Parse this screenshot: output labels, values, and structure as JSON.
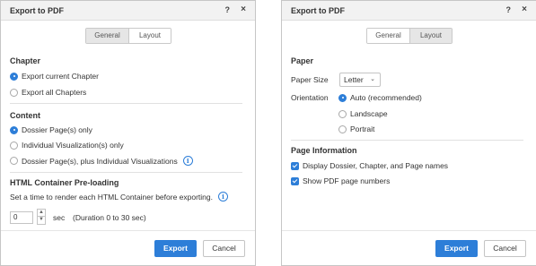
{
  "left": {
    "title": "Export to PDF",
    "help": "?",
    "close": "×",
    "tabs": [
      "General",
      "Layout"
    ],
    "chapter": {
      "heading": "Chapter",
      "options": [
        "Export current Chapter",
        "Export all Chapters"
      ],
      "selected": 0
    },
    "content": {
      "heading": "Content",
      "options": [
        "Dossier Page(s) only",
        "Individual Visualization(s) only",
        "Dossier Page(s), plus Individual Visualizations"
      ],
      "selected": 0
    },
    "preload": {
      "heading": "HTML Container Pre-loading",
      "description": "Set a time to render each HTML Container before exporting.",
      "value": "0",
      "unit": "sec",
      "hint": "(Duration 0 to 30 sec)"
    },
    "buttons": {
      "export": "Export",
      "cancel": "Cancel"
    }
  },
  "right": {
    "title": "Export to PDF",
    "help": "?",
    "close": "×",
    "tabs": [
      "General",
      "Layout"
    ],
    "paper": {
      "heading": "Paper",
      "size_label": "Paper Size",
      "size_value": "Letter",
      "orientation_label": "Orientation",
      "orientation_options": [
        "Auto (recommended)",
        "Landscape",
        "Portrait"
      ],
      "selected": 0
    },
    "page_info": {
      "heading": "Page Information",
      "options": [
        "Display Dossier, Chapter, and Page names",
        "Show PDF page numbers"
      ]
    },
    "buttons": {
      "export": "Export",
      "cancel": "Cancel"
    }
  },
  "icons": {
    "info": "info-icon",
    "chevron": "chevron-down-icon"
  },
  "colors": {
    "accent": "#2d7ed8"
  }
}
